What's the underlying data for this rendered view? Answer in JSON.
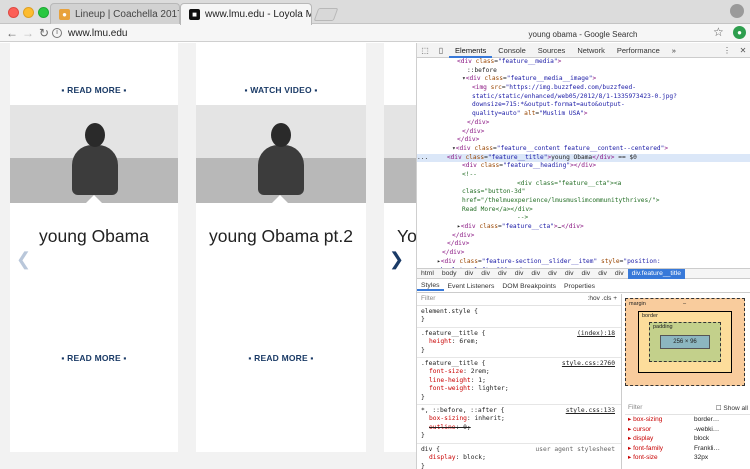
{
  "browser": {
    "tabs": [
      {
        "title": "Lineup | Coachella 2017",
        "active": false
      },
      {
        "title": "www.lmu.edu - Loyola Marymo",
        "active": true
      }
    ],
    "url": "www.lmu.edu",
    "devtools_window_title": "young obama - Google Search"
  },
  "page": {
    "top_links": [
      "READ MORE",
      "WATCH VIDEO"
    ],
    "cards": [
      {
        "title": "young Obama",
        "link": "READ MORE"
      },
      {
        "title": "young Obama pt.2",
        "link": "READ MORE"
      },
      {
        "title": "You"
      }
    ],
    "arrow_prev": "❮",
    "arrow_next": "❯"
  },
  "devtools": {
    "tabs": [
      "Elements",
      "Console",
      "Sources",
      "Network",
      "Performance",
      "»"
    ],
    "dom_lines": [
      {
        "indent": 8,
        "html": "<span class='tag'>&lt;div</span> <span class='attr'>class</span>=<span class='val'>\"feature__media\"</span><span class='tag'>&gt;</span>"
      },
      {
        "indent": 10,
        "html": "::before"
      },
      {
        "indent": 9,
        "html": "▾<span class='tag'>&lt;div</span> <span class='attr'>class</span>=<span class='val'>\"feature__media__image\"</span><span class='tag'>&gt;</span>"
      },
      {
        "indent": 11,
        "html": "<span class='tag'>&lt;img</span> <span class='attr'>src</span>=<span class='val'>\"https://img.buzzfeed.com/buzzfeed-</span>"
      },
      {
        "indent": 11,
        "html": "<span class='val'>static/static/enhanced/web05/2012/8/1-1335973423-0.jpg?</span>"
      },
      {
        "indent": 11,
        "html": "<span class='val'>downsize=715:*&amp;output-format=auto&amp;output-</span>"
      },
      {
        "indent": 11,
        "html": "<span class='val'>quality=auto\"</span> <span class='attr'>alt</span>=<span class='val'>\"Muslim USA\"</span><span class='tag'>&gt;</span>"
      },
      {
        "indent": 10,
        "html": "<span class='tag'>&lt;/div&gt;</span>"
      },
      {
        "indent": 9,
        "html": "<span class='tag'>&lt;/div&gt;</span>"
      },
      {
        "indent": 8,
        "html": "<span class='tag'>&lt;/div&gt;</span>"
      },
      {
        "indent": 7,
        "html": "▾<span class='tag'>&lt;div</span> <span class='attr'>class</span>=<span class='val'>\"feature__content feature__content--centered\"</span><span class='tag'>&gt;</span>"
      },
      {
        "indent": 0,
        "html": "...     <span class='tag'>&lt;div</span> <span class='attr'>class</span>=<span class='val'>\"feature__title\"</span><span class='tag'>&gt;</span>young Obama<span class='tag'>&lt;/div&gt;</span> == $0",
        "selected": true
      },
      {
        "indent": 9,
        "html": "<span class='tag'>&lt;div</span> <span class='attr'>class</span>=<span class='val'>\"feature__heading\"</span><span class='tag'>&gt;&lt;/div&gt;</span>"
      },
      {
        "indent": 9,
        "html": "<span class='cmt'>&lt;!--</span>"
      },
      {
        "indent": 20,
        "html": "<span class='cmt'>&lt;div class=\"feature__cta\"&gt;&lt;a</span>"
      },
      {
        "indent": 9,
        "html": "<span class='cmt'>class=\"button-3d\"</span>"
      },
      {
        "indent": 9,
        "html": "<span class='cmt'>href=\"/thelmuexperience/lmusmuslimcommunitythrives/\"&gt;</span>"
      },
      {
        "indent": 9,
        "html": "<span class='cmt'>Read More&lt;/a&gt;&lt;/div&gt;</span>"
      },
      {
        "indent": 20,
        "html": "<span class='cmt'>--&gt;</span>"
      },
      {
        "indent": 8,
        "html": "▸<span class='tag'>&lt;div</span> <span class='attr'>class</span>=<span class='val'>\"feature__cta\"</span><span class='tag'>&gt;</span>…<span class='tag'>&lt;/div&gt;</span>"
      },
      {
        "indent": 7,
        "html": "<span class='tag'>&lt;/div&gt;</span>"
      },
      {
        "indent": 6,
        "html": "<span class='tag'>&lt;/div&gt;</span>"
      },
      {
        "indent": 5,
        "html": "<span class='tag'>&lt;/div&gt;</span>"
      },
      {
        "indent": 4,
        "html": "▸<span class='tag'>&lt;div</span> <span class='attr'>class</span>=<span class='val'>\"feature-section__slider__item\"</span> <span class='attr'>style</span>=<span class='val'>\"position:</span>"
      },
      {
        "indent": 4,
        "html": "<span class='val'>absolute; left: 320px;\"</span><span class='tag'>&gt;</span>"
      }
    ],
    "breadcrumbs": [
      "html",
      "body",
      "div",
      "div",
      "div",
      "div",
      "div",
      "div",
      "div",
      "div",
      "div",
      "div",
      "div.feature__title"
    ],
    "sub_tabs": [
      "Styles",
      "Event Listeners",
      "DOM Breakpoints",
      "Properties"
    ],
    "filter_placeholder": "Filter",
    "filter_right": ":hov  .cls  +",
    "rules": [
      {
        "selector": "element.style {",
        "src": "",
        "props": []
      },
      {
        "selector": ".feature__title {",
        "src": "(index):18",
        "props": [
          {
            "name": "height",
            "value": "6rem;"
          }
        ]
      },
      {
        "selector": ".feature__title {",
        "src": "style.css:2760",
        "props": [
          {
            "name": "font-size",
            "value": "2rem;"
          },
          {
            "name": "line-height",
            "value": "1;"
          },
          {
            "name": "font-weight",
            "value": "lighter;"
          }
        ]
      },
      {
        "selector": "*, ::before, ::after {",
        "src": "style.css:133",
        "props": [
          {
            "name": "box-sizing",
            "value": "inherit;"
          },
          {
            "name": "outline",
            "value": "0;",
            "strike": true
          }
        ]
      },
      {
        "selector": "div {",
        "src": "user agent stylesheet",
        "props": [
          {
            "name": "display",
            "value": "block;"
          }
        ]
      }
    ],
    "box_model": {
      "margin": "margin",
      "border": "border",
      "padding": "padding",
      "content": "256 × 96",
      "dash": "–"
    },
    "computed": {
      "filter": "Filter",
      "show_all": "Show all",
      "rows": [
        {
          "k": "box-sizing",
          "v": "border…"
        },
        {
          "k": "cursor",
          "v": "-webki…"
        },
        {
          "k": "display",
          "v": "block"
        },
        {
          "k": "font-family",
          "v": "Frankli…"
        },
        {
          "k": "font-size",
          "v": "32px"
        }
      ]
    }
  }
}
